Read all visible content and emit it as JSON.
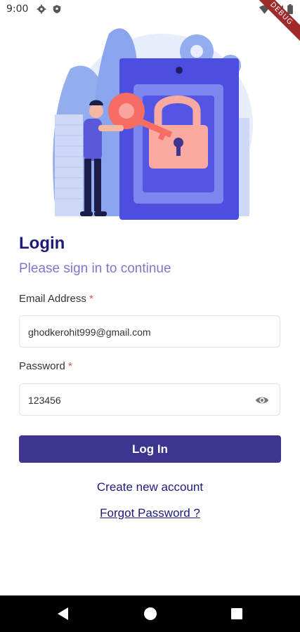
{
  "status_bar": {
    "time": "9:00",
    "debug_label": "DEBUG"
  },
  "login": {
    "title": "Login",
    "subtitle": "Please sign in to continue",
    "email": {
      "label": "Email Address",
      "required_mark": "*",
      "value": "ghodkerohit999@gmail.com"
    },
    "password": {
      "label": "Password",
      "required_mark": "*",
      "value": "123456"
    },
    "submit_label": "Log In",
    "create_account_label": "Create new account",
    "forgot_password_label": "Forgot Password ?"
  },
  "colors": {
    "primary": "#3d3590",
    "title": "#1d1a78",
    "subtitle": "#7b78c9",
    "required": "#d9534f"
  },
  "icons": [
    "settings-icon",
    "shield-icon",
    "wifi-icon",
    "signal-icon",
    "battery-icon",
    "visibility-icon",
    "back-icon",
    "home-icon",
    "recents-icon"
  ]
}
